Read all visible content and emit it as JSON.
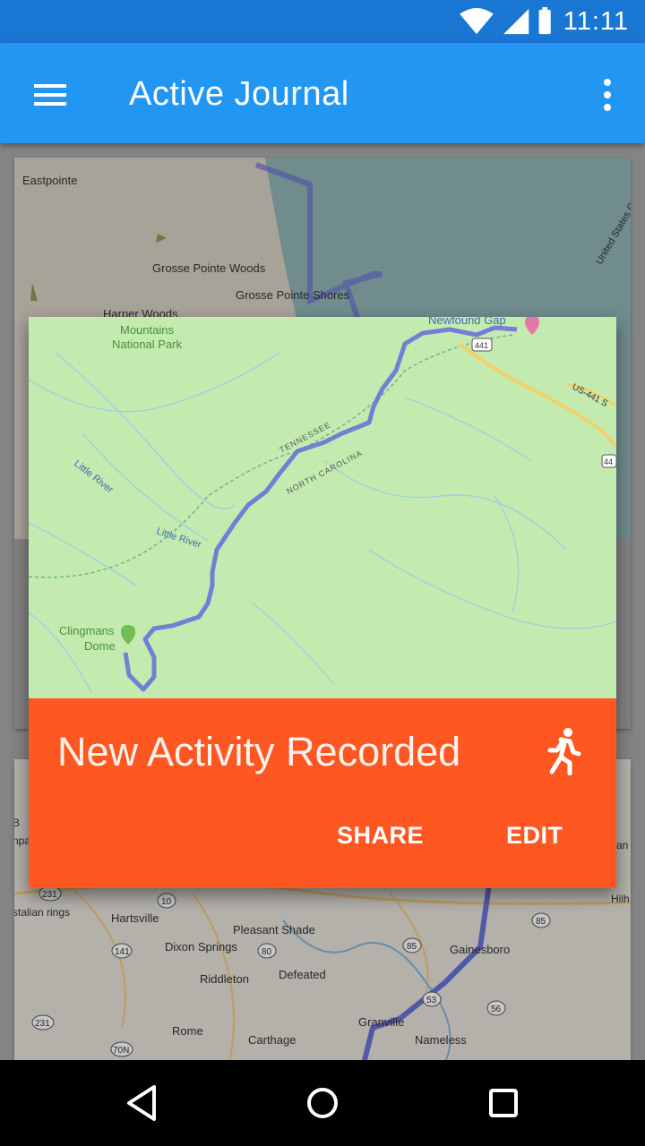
{
  "status_bar": {
    "time": "11:11",
    "icons": [
      "wifi-icon",
      "cell-signal-icon",
      "battery-icon"
    ]
  },
  "app_bar": {
    "title": "Active Journal",
    "menu_icon": "menu-icon",
    "overflow_icon": "more-vert-icon"
  },
  "background_cards": [
    {
      "map_labels": [
        "Eastpointe",
        "Grosse Pointe Woods",
        "Grosse Pointe Shores",
        "Harper Woods",
        "United States Ca"
      ]
    },
    {
      "map_labels": [
        "231",
        "10",
        "Hartsville",
        "Pleasant Shade",
        "85",
        "141",
        "Dixon Springs",
        "80",
        "85",
        "Gainesboro",
        "Riddleton",
        "Defeated",
        "53",
        "231",
        "56",
        "Rome",
        "Granville",
        "Carthage",
        "Nameless",
        "70N",
        "85",
        "stalian rings",
        "Hilh",
        "an St",
        "npa",
        "B"
      ]
    }
  ],
  "dialog": {
    "title": "New Activity Recorded",
    "activity_icon": "directions-run-icon",
    "actions": {
      "share": "SHARE",
      "edit": "EDIT"
    },
    "map": {
      "labels": {
        "park": "Great Smoky Mountains National Park",
        "park_line1": "Mountains",
        "park_line2": "National Park",
        "newfound_gap": "Newfound Gap",
        "route_441": "441",
        "us_441": "US-441 S",
        "route_44": "44",
        "tennessee": "TENNESSEE",
        "north_carolina": "NORTH CAROLINA",
        "little_river_1": "Little River",
        "little_river_2": "Little River",
        "clingmans_1": "Clingmans",
        "clingmans_2": "Dome"
      }
    }
  },
  "colors": {
    "status_bar": "#1976d2",
    "app_bar": "#2196f3",
    "dialog_panel": "#ff5722",
    "map_green": "#c3ebb0",
    "route": "#6b72d8"
  },
  "nav_bar": {
    "back_icon": "back-icon",
    "home_icon": "home-icon",
    "recents_icon": "recents-icon"
  }
}
